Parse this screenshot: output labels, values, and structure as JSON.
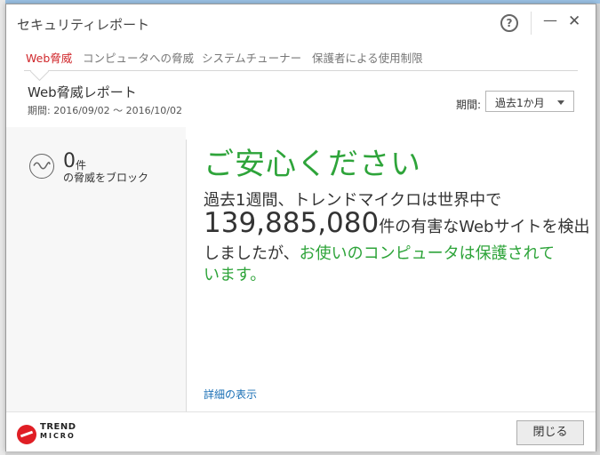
{
  "window": {
    "title": "セキュリティレポート",
    "help_label": "?",
    "minimize_label": "—",
    "close_label": "✕"
  },
  "tabs": [
    {
      "label": "Web脅威",
      "active": true
    },
    {
      "label": "コンピュータへの脅威",
      "active": false
    },
    {
      "label": "システムチューナー",
      "active": false
    },
    {
      "label": "保護者による使用制限",
      "active": false
    }
  ],
  "report": {
    "title": "Web脅威レポート",
    "period_range": "期間: 2016/09/02 〜 2016/10/02"
  },
  "period_selector": {
    "label": "期間:",
    "value": "過去1か月"
  },
  "summary": {
    "count": "0",
    "unit": "件",
    "description": "の脅威をブロック"
  },
  "message": {
    "headline": "ご安心ください",
    "line1": "過去1週間、トレンドマイクロは世界中で",
    "number": "139,885,080",
    "line2_suffix": "件の有害なWebサイトを検出",
    "line3_prefix": "しましたが、",
    "line3_green": "お使いのコンピュータは保護されて",
    "line4_green": "います。"
  },
  "details_link": "詳細の表示",
  "footer": {
    "logo_line1": "TREND",
    "logo_line2": "MICRO",
    "close_button": "閉じる"
  },
  "colors": {
    "accent_red": "#d0272b",
    "safe_green": "#2ea43a",
    "link_blue": "#1a6fb5"
  }
}
